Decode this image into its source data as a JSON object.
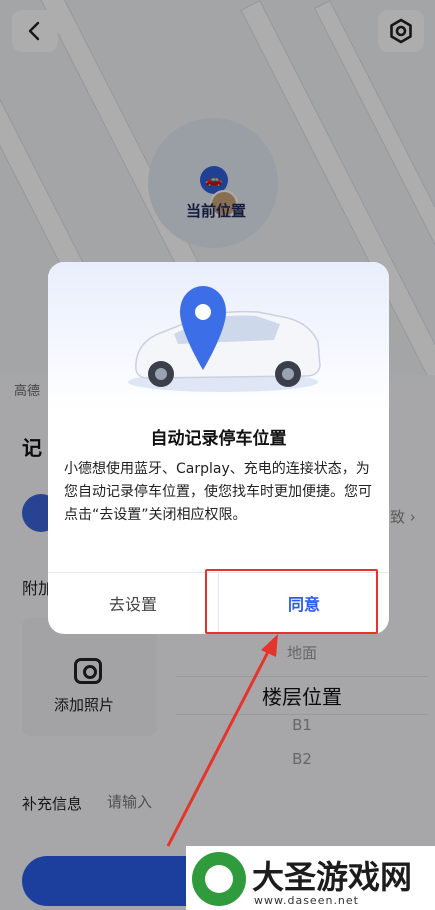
{
  "map": {
    "current_location_label": "当前位置"
  },
  "page": {
    "provider_text": "高德",
    "section_title": "记",
    "car_row_right_text": "致 ›",
    "extra_label": "附加",
    "photo_label": "添加照片",
    "floor_picker": {
      "options_above": [
        "地面"
      ],
      "selected": "楼层位置",
      "options_below": [
        "B1",
        "B2"
      ]
    },
    "supplement_label": "补充信息",
    "supplement_placeholder": "请输入"
  },
  "dialog": {
    "title": "自动记录停车位置",
    "body": "小德想使用蓝牙、Carplay、充电的连接状态，为您自动记录停车位置，使您找车时更加便捷。您可点击“去设置”关闭相应权限。",
    "settings_button": "去设置",
    "agree_button": "同意"
  },
  "annotation": {
    "highlight_color": "#e5342a"
  },
  "watermark": {
    "text": "大圣游戏网",
    "url": "www.daseen.net"
  },
  "colors": {
    "accent": "#2a5ce8",
    "annotation": "#e5342a"
  }
}
